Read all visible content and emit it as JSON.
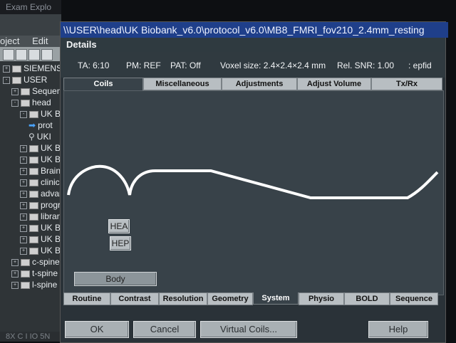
{
  "explorer": {
    "title": "Exam Explo",
    "menu": [
      "oject",
      "Edit"
    ],
    "tree": [
      {
        "label": "SIEMENS",
        "level": 0,
        "kind": "folder",
        "toggle": "+"
      },
      {
        "label": "USER",
        "level": 0,
        "kind": "folder",
        "toggle": "-"
      },
      {
        "label": "Sequence",
        "level": 1,
        "kind": "folder",
        "toggle": "+"
      },
      {
        "label": "head",
        "level": 1,
        "kind": "folder",
        "toggle": "-"
      },
      {
        "label": "UK Bio",
        "level": 2,
        "kind": "folder",
        "toggle": "-"
      },
      {
        "label": "prot",
        "level": 3,
        "kind": "arrow",
        "toggle": ""
      },
      {
        "label": "UKI",
        "level": 3,
        "kind": "item",
        "toggle": ""
      },
      {
        "label": "UK Bio",
        "level": 2,
        "kind": "folder",
        "toggle": "+"
      },
      {
        "label": "UK Bio",
        "level": 2,
        "kind": "folder",
        "toggle": "+"
      },
      {
        "label": "Brain D",
        "level": 2,
        "kind": "folder",
        "toggle": "+"
      },
      {
        "label": "clinica",
        "level": 2,
        "kind": "folder",
        "toggle": "+"
      },
      {
        "label": "advanc",
        "level": 2,
        "kind": "folder",
        "toggle": "+"
      },
      {
        "label": "progra",
        "level": 2,
        "kind": "folder",
        "toggle": "+"
      },
      {
        "label": "library",
        "level": 2,
        "kind": "folder",
        "toggle": "+"
      },
      {
        "label": "UK Bio",
        "level": 2,
        "kind": "folder",
        "toggle": "+"
      },
      {
        "label": "UK Bio",
        "level": 2,
        "kind": "folder",
        "toggle": "+"
      },
      {
        "label": "UK Bio",
        "level": 2,
        "kind": "folder",
        "toggle": "+"
      },
      {
        "label": "c-spine",
        "level": 1,
        "kind": "folder",
        "toggle": "+"
      },
      {
        "label": "t-spine",
        "level": 1,
        "kind": "folder",
        "toggle": "+"
      },
      {
        "label": "l-spine",
        "level": 1,
        "kind": "folder",
        "toggle": "+"
      }
    ],
    "status": "8X C I IO 5N"
  },
  "dialog": {
    "title": "\\\\USER\\head\\UK Biobank_v6.0\\protocol_v6.0\\MB8_FMRI_fov210_2.4mm_resting",
    "section": "Details",
    "info": {
      "ta": "TA: 6:10",
      "pm": "PM: REF",
      "pat": "PAT: Off",
      "voxel": "Voxel size: 2.4×2.4×2.4 mm",
      "snr": "Rel. SNR: 1.00",
      "seq": ": epfid"
    },
    "tabs": [
      "Coils",
      "Miscellaneous",
      "Adjustments",
      "Adjust Volume",
      "Tx/Rx"
    ],
    "active_tab": "Coils",
    "coils": {
      "hea": "HEA",
      "hep": "HEP",
      "body": "Body"
    },
    "bottom_tabs": [
      "Routine",
      "Contrast",
      "Resolution",
      "Geometry",
      "System",
      "Physio",
      "BOLD",
      "Sequence"
    ],
    "active_bottom_tab": "System",
    "buttons": {
      "ok": "OK",
      "cancel": "Cancel",
      "virtual_coils": "Virtual Coils...",
      "help": "Help"
    }
  },
  "colors": {
    "titlebar": "#1f3f8a",
    "panel": "#384249",
    "button": "#b8bec2"
  }
}
